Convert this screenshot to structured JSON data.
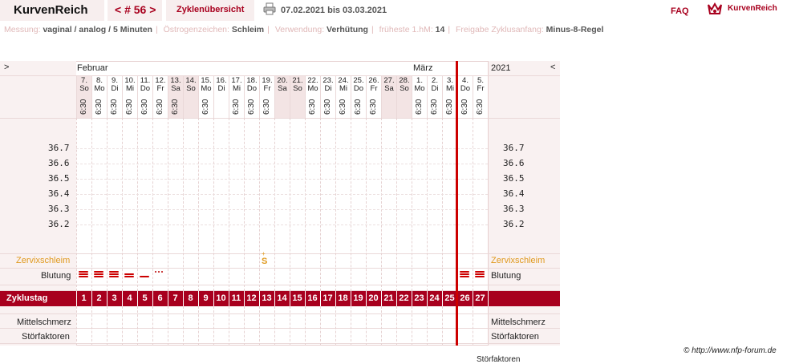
{
  "header": {
    "brand": "KurvenReich",
    "cycle_nav": "< # 56 >",
    "overview_tab": "Zyklenübersicht",
    "date_range": "07.02.2021 bis 03.03.2021",
    "faq": "FAQ",
    "logo_text": "KurvenReich"
  },
  "info": {
    "messung_label": "Messung:",
    "messung_value": "vaginal / analog / 5 Minuten",
    "oestrogen_label": "Östrogenzeichen:",
    "oestrogen_value": "Schleim",
    "verwendung_label": "Verwendung:",
    "verwendung_value": "Verhütung",
    "hm_label": "früheste 1.hM:",
    "hm_value": "14",
    "freigabe_label": "Freigabe Zyklusanfang:",
    "freigabe_value": "Minus-8-Regel"
  },
  "chart": {
    "nav_left": ">",
    "nav_right": "<",
    "month_feb": "Februar",
    "month_mar": "März",
    "year": "2021",
    "days": [
      {
        "d": "7.",
        "w": "So",
        "t": "6:30",
        "we": true
      },
      {
        "d": "8.",
        "w": "Mo",
        "t": "6:30",
        "we": false
      },
      {
        "d": "9.",
        "w": "Di",
        "t": "6:30",
        "we": false
      },
      {
        "d": "10.",
        "w": "Mi",
        "t": "6:30",
        "we": false
      },
      {
        "d": "11.",
        "w": "Do",
        "t": "6:30",
        "we": false
      },
      {
        "d": "12.",
        "w": "Fr",
        "t": "6:30",
        "we": false
      },
      {
        "d": "13.",
        "w": "Sa",
        "t": "6:30",
        "we": true
      },
      {
        "d": "14.",
        "w": "So",
        "t": "",
        "we": true
      },
      {
        "d": "15.",
        "w": "Mo",
        "t": "6:30",
        "we": false
      },
      {
        "d": "16.",
        "w": "Di",
        "t": "",
        "we": false
      },
      {
        "d": "17.",
        "w": "Mi",
        "t": "6:30",
        "we": false
      },
      {
        "d": "18.",
        "w": "Do",
        "t": "6:30",
        "we": false
      },
      {
        "d": "19.",
        "w": "Fr",
        "t": "6:30",
        "we": false
      },
      {
        "d": "20.",
        "w": "Sa",
        "t": "",
        "we": true
      },
      {
        "d": "21.",
        "w": "So",
        "t": "",
        "we": true
      },
      {
        "d": "22.",
        "w": "Mo",
        "t": "6:30",
        "we": false
      },
      {
        "d": "23.",
        "w": "Di",
        "t": "6:30",
        "we": false
      },
      {
        "d": "24.",
        "w": "Mi",
        "t": "6:30",
        "we": false
      },
      {
        "d": "25.",
        "w": "Do",
        "t": "6:30",
        "we": false
      },
      {
        "d": "26.",
        "w": "Fr",
        "t": "6:30",
        "we": false
      },
      {
        "d": "27.",
        "w": "Sa",
        "t": "",
        "we": true
      },
      {
        "d": "28.",
        "w": "So",
        "t": "",
        "we": true
      },
      {
        "d": "1.",
        "w": "Mo",
        "t": "6:30",
        "we": false
      },
      {
        "d": "2.",
        "w": "Di",
        "t": "6:30",
        "we": false
      },
      {
        "d": "3.",
        "w": "Mi",
        "t": "6:30",
        "we": false
      },
      {
        "d": "4.",
        "w": "Do",
        "t": "6:30",
        "we": false
      },
      {
        "d": "5.",
        "w": "Fr",
        "t": "6:30",
        "we": false
      }
    ],
    "temps": [
      "36.7",
      "36.6",
      "36.5",
      "36.4",
      "36.3",
      "36.2"
    ],
    "cervix_label": "Zervixschleim",
    "cervix_mark": "S",
    "cervix_mark_sup": "+",
    "bleeding_label": "Blutung",
    "bleeding": [
      "heavy",
      "heavy",
      "heavy",
      "medium",
      "light",
      "spotting",
      "",
      "",
      "",
      "",
      "",
      "",
      "",
      "",
      "",
      "",
      "",
      "",
      "",
      "",
      "",
      "",
      "",
      "",
      "",
      "heavy",
      "heavy"
    ],
    "cycle_day_label": "Zyklustag",
    "cycle_days": [
      "1",
      "2",
      "3",
      "4",
      "5",
      "6",
      "7",
      "8",
      "9",
      "10",
      "11",
      "12",
      "13",
      "14",
      "15",
      "16",
      "17",
      "18",
      "19",
      "20",
      "21",
      "22",
      "23",
      "24",
      "25",
      "26",
      "27"
    ],
    "pain_label": "Mittelschmerz",
    "disturb_label": "Störfaktoren"
  },
  "footer": {
    "copyright": "© http://www.nfp-forum.de",
    "stoerfaktoren": "Störfaktoren"
  },
  "colors": {
    "accent": "#a8001e",
    "cervix": "#e09a20",
    "cycle_line": "#cc0000"
  }
}
